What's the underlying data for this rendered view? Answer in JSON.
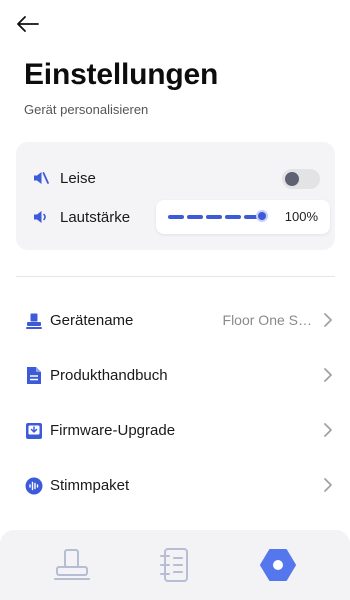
{
  "header": {
    "title": "Einstellungen",
    "subtitle": "Gerät personalisieren"
  },
  "sound_card": {
    "mute_label": "Leise",
    "mute_on": false,
    "volume_label": "Lautstärke",
    "volume_value": "100%",
    "volume_level": 1.0
  },
  "settings": [
    {
      "label": "Gerätename",
      "value": "Floor One S…",
      "icon": "device-icon"
    },
    {
      "label": "Produkthandbuch",
      "value": "",
      "icon": "document-icon"
    },
    {
      "label": "Firmware-Upgrade",
      "value": "",
      "icon": "firmware-icon"
    },
    {
      "label": "Stimmpaket",
      "value": "",
      "icon": "voice-wave-icon"
    }
  ],
  "nav": {
    "items": [
      "device-nav-icon",
      "manual-nav-icon",
      "settings-nav-icon"
    ],
    "active_index": 2
  },
  "colors": {
    "accent": "#3d5bd9",
    "accent_active": "#5577ee",
    "inactive_icon": "#b6bdd4",
    "card_bg": "#f4f4f6"
  }
}
